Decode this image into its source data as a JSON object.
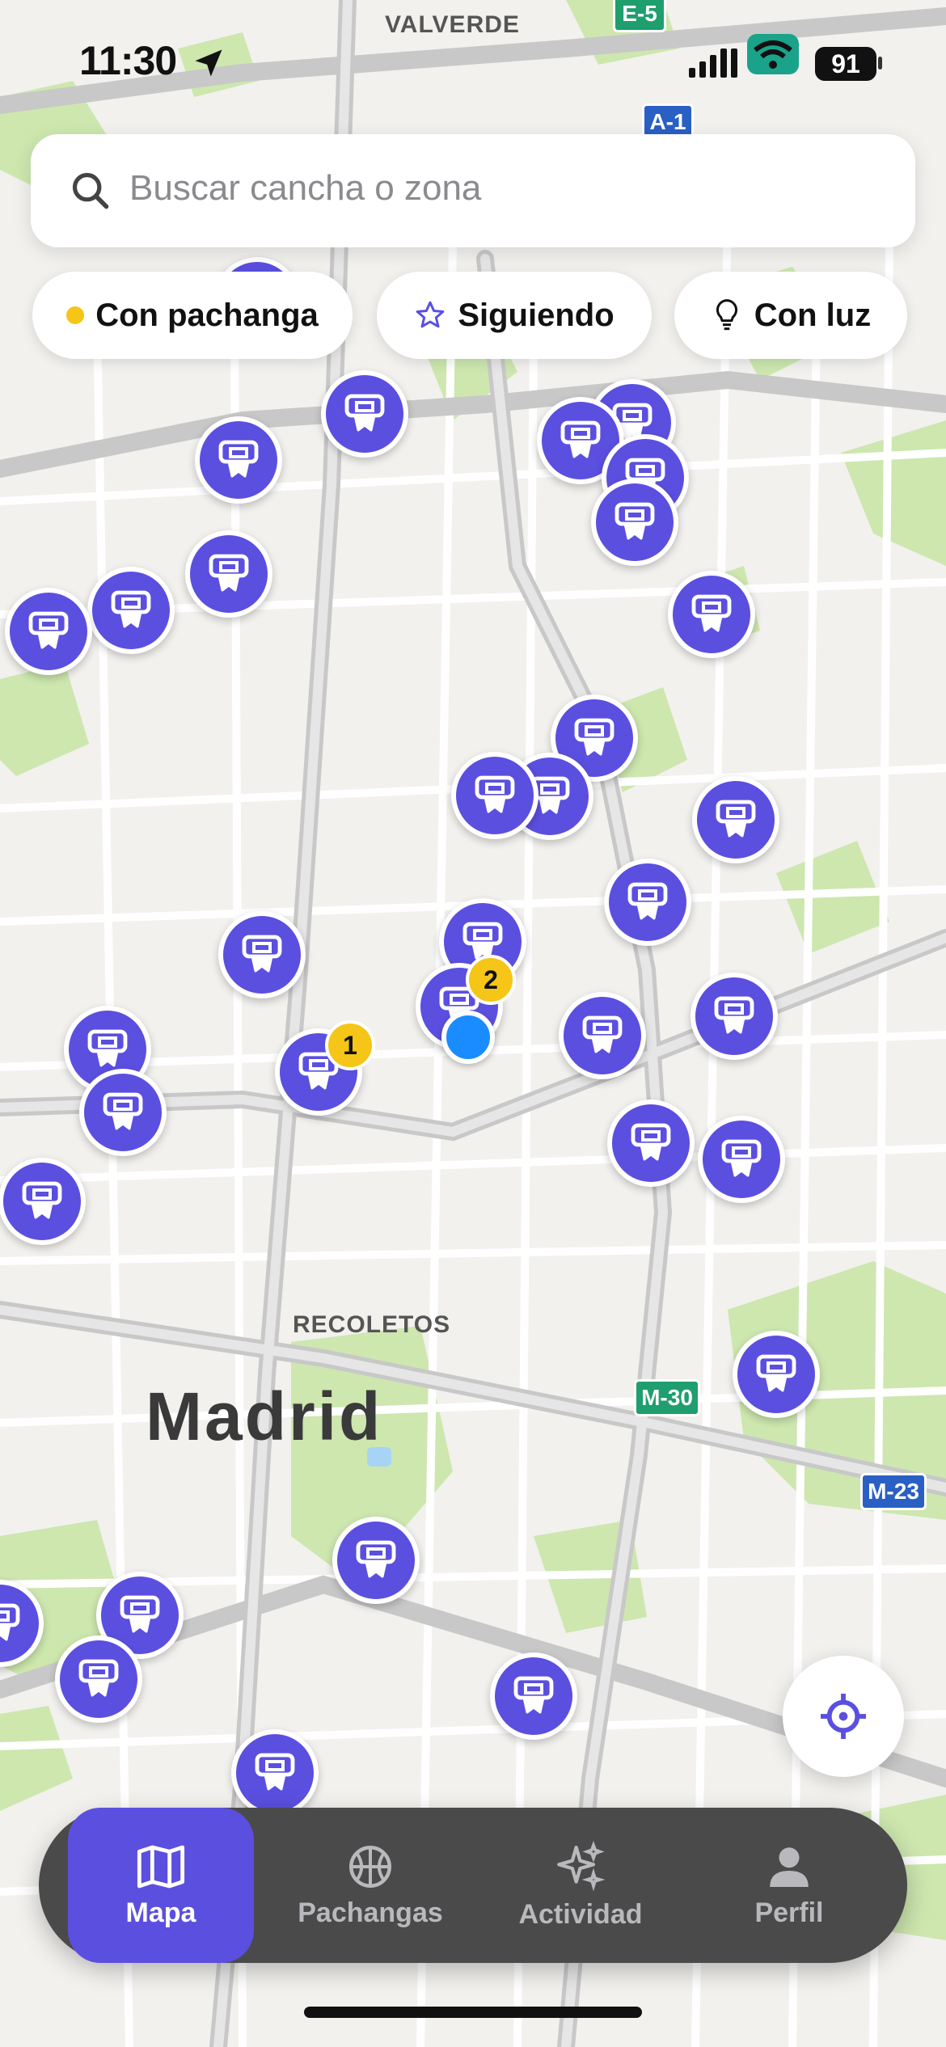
{
  "status_bar": {
    "time": "11:30",
    "battery": "91"
  },
  "search": {
    "placeholder": "Buscar cancha o zona"
  },
  "filters": [
    {
      "label": "Con pachanga",
      "icon": "yellow-dot"
    },
    {
      "label": "Siguiendo",
      "icon": "star-icon"
    },
    {
      "label": "Con luz",
      "icon": "lightbulb-icon"
    }
  ],
  "map": {
    "city_label": "Madrid",
    "district_labels": [
      "VALVERDE",
      "RECOLETOS"
    ],
    "road_shields": [
      "E-5",
      "A-1",
      "M-30",
      "M-23"
    ],
    "court_markers_count": 40,
    "badges": [
      "1",
      "2"
    ],
    "colors": {
      "marker": "#5b4fe0",
      "badge": "#f5c518",
      "user_location": "#1a8cff"
    }
  },
  "tabbar": {
    "tabs": [
      {
        "label": "Mapa",
        "icon": "map-icon",
        "active": true
      },
      {
        "label": "Pachangas",
        "icon": "basketball-icon",
        "active": false
      },
      {
        "label": "Actividad",
        "icon": "sparkles-icon",
        "active": false
      },
      {
        "label": "Perfil",
        "icon": "person-icon",
        "active": false
      }
    ]
  }
}
